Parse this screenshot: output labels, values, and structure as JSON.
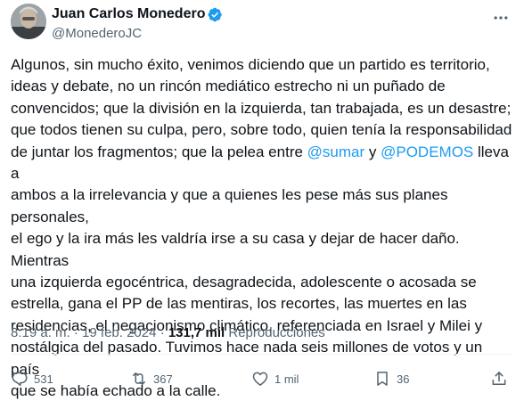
{
  "author": {
    "display_name": "Juan Carlos Monedero",
    "handle": "@MonederoJC"
  },
  "tweet": {
    "segments": [
      {
        "text": "Algunos, sin mucho éxito, venimos diciendo que un partido es territorio,\nideas y debate, no un rincón mediático estrecho ni un puñado de\nconvencidos; que la división en la izquierda, tan trabajada, es un desastre;\nque todos tienen su culpa, pero, sobre todo, quien tenía la responsabilidad\nde juntar los fragmentos; que la pelea entre ",
        "type": "text"
      },
      {
        "text": "@sumar",
        "type": "mention"
      },
      {
        "text": " y ",
        "type": "text"
      },
      {
        "text": "@PODEMOS",
        "type": "mention"
      },
      {
        "text": " lleva a\nambos a la irrelevancia y que a quienes les pese más sus planes personales,\nel ego y la ira más les valdría irse a su casa y dejar de hacer daño. Mientras\nuna izquierda egocéntrica, desagradecida, adolescente o acosada se\nestrella, gana el PP de las mentiras, los recortes, las muertes en las\nresidencias, el negacionismo climático, referenciada en Israel y Milei y\nnostálgica del pasado. Tuvimos hace nada seis millones de votos y un país\nque se había echado a la calle.",
        "type": "text"
      }
    ]
  },
  "meta": {
    "time": "8:19 a. m.",
    "separator": " · ",
    "date": "19 feb. 2024",
    "views_count": "131,7 mil",
    "views_label": "Reproducciones"
  },
  "actions": {
    "replies": "531",
    "reposts": "367",
    "likes": "1 mil",
    "bookmarks": "36"
  },
  "icons": {
    "verified": "verified-badge-icon",
    "more": "more-icon",
    "reply": "reply-icon",
    "repost": "repost-icon",
    "like": "heart-icon",
    "bookmark": "bookmark-icon",
    "share": "share-icon"
  },
  "colors": {
    "accent": "#1d9bf0",
    "text": "#0f1419",
    "secondary": "#536471"
  }
}
